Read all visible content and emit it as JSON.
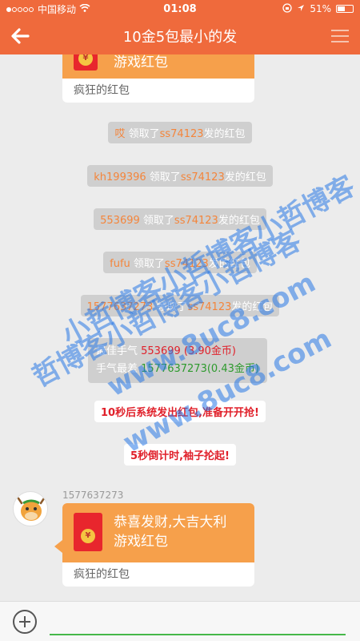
{
  "status": {
    "carrier": "中国移动",
    "time": "01:08",
    "battery": "51%"
  },
  "nav": {
    "title": "10金5包最小的发"
  },
  "messages": {
    "red_packet_top_text": "游戏红包",
    "red_packet_top_footer": "疯狂的红包",
    "sys1_name": "哎",
    "sys1_action": " 领取了",
    "sys1_sender": "ss74123",
    "sys1_tail": "发的红包",
    "sys2_name": "kh199396",
    "sys2_action": " 领取了",
    "sys2_sender": "ss74123",
    "sys2_tail": "发的红包",
    "sys3_name": "553699",
    "sys3_action": " 领取了",
    "sys3_sender": "ss74123",
    "sys3_tail": "发的红包",
    "sys4_name": "fufu",
    "sys4_action": " 领取了",
    "sys4_sender": "ss74123",
    "sys4_tail": "发的红包",
    "sys5_name": "1577637273",
    "sys5_action": " 领取了",
    "sys5_sender": "ss74123",
    "sys5_tail": "发的红包",
    "luck_best_label": "最佳手气 ",
    "luck_best_value": "553699 (3.90金币)",
    "luck_worst_label": "手气最差 ",
    "luck_worst_value": "1577637273(0.43金币)",
    "notice1": "10秒后系统发出红包,准备开开抢!",
    "notice2": "5秒倒计时,袖子抡起!",
    "sender_name": "1577637273",
    "rp_line1": "恭喜发财,大吉大利",
    "rp_line2": "游戏红包",
    "rp_footer": "疯狂的红包",
    "coin_symbol": "¥"
  },
  "watermark": {
    "line1": "小哲博客小哲博客小哲博客",
    "line2": "哲博客小哲博客小哲博客",
    "line3": "www.8uc8.com",
    "line4": "www.8uc8.com"
  },
  "colors": {
    "header": "#ef6a3c",
    "packet": "#f6a04b",
    "accent_green": "#46b84a"
  }
}
